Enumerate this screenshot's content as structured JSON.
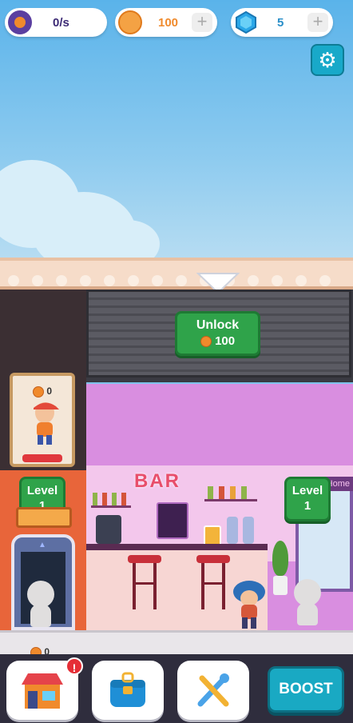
{
  "hud": {
    "income_rate": "0/s",
    "coins": "100",
    "gems": "5",
    "plus": "+"
  },
  "icons": {
    "settings": "gear-icon",
    "coin": "coin-icon",
    "gem": "gem-icon"
  },
  "locked_floor": {
    "unlock_label": "Unlock",
    "unlock_cost": "100"
  },
  "elevator": {
    "cash": "0",
    "level_label": "Level",
    "level_value": "1"
  },
  "bar": {
    "sign": "BAR",
    "level_label": "Level",
    "level_value": "1",
    "side_sign": "Home"
  },
  "lobby": {
    "cash": "0"
  },
  "bottom_bar": {
    "boost_label": "BOOST",
    "alert": "!"
  },
  "colors": {
    "accent_green": "#2fa34a",
    "boost_teal": "#19a9c3",
    "coin_orange": "#f08a2c",
    "gem_blue": "#2aa7e8"
  }
}
